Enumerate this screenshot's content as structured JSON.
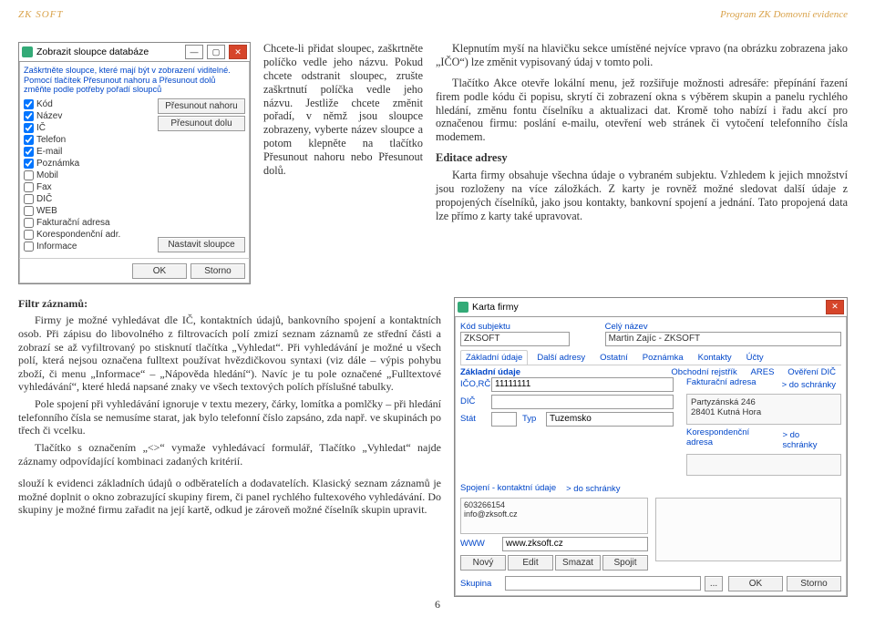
{
  "header": {
    "left": "ZK SOFT",
    "right": "Program ZK Domovní evidence"
  },
  "win_cols": {
    "title": "Zobrazit sloupce databáze",
    "desc": "Zaškrtněte sloupce, které mají být v zobrazení viditelné. Pomocí tlačítek Přesunout nahoru a Přesunout dolů změňte podle potřeby pořadí sloupců",
    "items": [
      {
        "checked": true,
        "label": "Kód"
      },
      {
        "checked": true,
        "label": "Název"
      },
      {
        "checked": true,
        "label": "IČ"
      },
      {
        "checked": true,
        "label": "Telefon"
      },
      {
        "checked": true,
        "label": "E-mail"
      },
      {
        "checked": true,
        "label": "Poznámka"
      },
      {
        "checked": false,
        "label": "Mobil"
      },
      {
        "checked": false,
        "label": "Fax"
      },
      {
        "checked": false,
        "label": "DIČ"
      },
      {
        "checked": false,
        "label": "WEB"
      },
      {
        "checked": false,
        "label": "Fakturační adresa"
      },
      {
        "checked": false,
        "label": "Korespondenční adr."
      },
      {
        "checked": false,
        "label": "Informace"
      }
    ],
    "btn_up": "Přesunout nahoru",
    "btn_down": "Přesunout dolu",
    "btn_set": "Nastavit sloupce",
    "btn_ok": "OK",
    "btn_cancel": "Storno"
  },
  "para1": "Chcete-li přidat sloupec, zaškrtněte políčko vedle jeho názvu. Pokud chcete odstranit sloupec, zrušte zaškrtnutí políčka vedle jeho názvu. Jestliže chcete změnit pořadí, v němž jsou sloupce zobrazeny, vyberte název sloupce a potom klepněte na tlačítko Přesunout nahoru nebo Přesunout dolů.",
  "para2": "Klepnutím myší na hlavičku sekce umístěné nejvíce vpravo (na obrázku zobrazena jako „IČO“) lze změnit vypisovaný údaj v tomto poli.",
  "para3": "Tlačítko Akce otevře lokální menu, jež rozšiřuje možnosti adresáře: přepínání řazení firem podle kódu či popisu, skrytí či zobrazení okna s výběrem skupin a panelu rychlého hledání, změnu fontu číselníku a aktualizaci dat. Kromě toho nabízí i řadu akcí pro označenou firmu: poslání e-mailu, otevření web stránek či vytočení telefonního čísla modemem.",
  "h_edit": "Editace adresy",
  "para4": "Karta firmy obsahuje všechna údaje o vybraném subjektu. Vzhledem k jejich množství jsou rozloženy na více záložkách. Z karty je rovněž možné sledovat další údaje z propojených číselníků, jako jsou kontakty, bankovní spojení a jednání. Tato propojená data lze přímo z karty také upravovat.",
  "h_filter": "Filtr záznamů:",
  "para_filter": "Firmy je možné vyhledávat dle IČ, kontaktních údajů, bankovního spojení a kontaktních osob. Při zápisu do libovolného z filtrovacích polí zmizí seznam záznamů ze střední části a zobrazí se až vyfiltrovaný po stisknutí tlačítka „Vyhledat“. Při vyhledávání je možné u všech polí, která nejsou označena fulltext používat hvězdičkovou syntaxi (viz dále – výpis pohybu zboží, či menu „Informace“ – „Nápověda hledání“). Navíc je tu pole označené „Fulltextové vyhledávání“, které hledá napsané znaky ve všech textových polích příslušné tabulky.",
  "para_filter2": "Pole spojení při vyhledávání ignoruje v textu mezery, čárky, lomítka a pomlčky – při hledání telefonního čísla se nemusíme starat, jak bylo telefonní číslo zapsáno, zda např. ve skupinách po třech či vcelku.",
  "para_filter3": "Tlačítko s označením „<>“ vymaže vyhledávací formulář, Tlačítko „Vyhledat“ najde záznamy odpovídající kombinaci zadaných kritérií.",
  "para_filter4": "slouží k evidenci základních údajů o odběratelích a dodavatelích. Klasický seznam záznamů je možné doplnit o okno zobrazující skupiny firem, či panel rychlého fultexového vyhledávání. Do skupiny je možné firmu zařadit na její kartě, odkud je zároveň možné číselník skupin upravit.",
  "win_card": {
    "title": "Karta firmy",
    "lbl_kod": "Kód subjektu",
    "val_kod": "ZKSOFT",
    "lbl_nazev": "Celý název",
    "val_nazev": "Martin Zajíc - ZKSOFT",
    "tabs": [
      "Základní údaje",
      "Další adresy",
      "Ostatní",
      "Poznámka",
      "Kontakty",
      "Účty"
    ],
    "rlinks": [
      "Obchodní rejstřík",
      "ARES",
      "Ověření DIČ"
    ],
    "basic_title": "Základní údaje",
    "lbl_ico": "IČO,RČ",
    "val_ico": "11111111",
    "lbl_dic": "DIČ",
    "val_dic": "",
    "lbl_stat": "Stát",
    "lbl_typ": "Typ",
    "val_typ": "Tuzemsko",
    "fak_title": "Fakturační adresa",
    "fak_link": "> do schránky",
    "fak_addr1": "Partyzánská 246",
    "fak_addr2": "28401 Kutná Hora",
    "kor_title": "Korespondenční adresa",
    "kor_link": "> do schránky",
    "spoj_title": "Spojení - kontaktní údaje",
    "spoj_link": "> do schránky",
    "tel": "603266154",
    "mail": "info@zksoft.cz",
    "web": "www.zksoft.cz",
    "btn_new": "Nový",
    "btn_edit": "Edit",
    "btn_del": "Smazat",
    "btn_merge": "Spojit",
    "lbl_skupina": "Skupina",
    "dots": "...",
    "btn_ok": "OK",
    "btn_cancel": "Storno"
  },
  "page_num": "6"
}
